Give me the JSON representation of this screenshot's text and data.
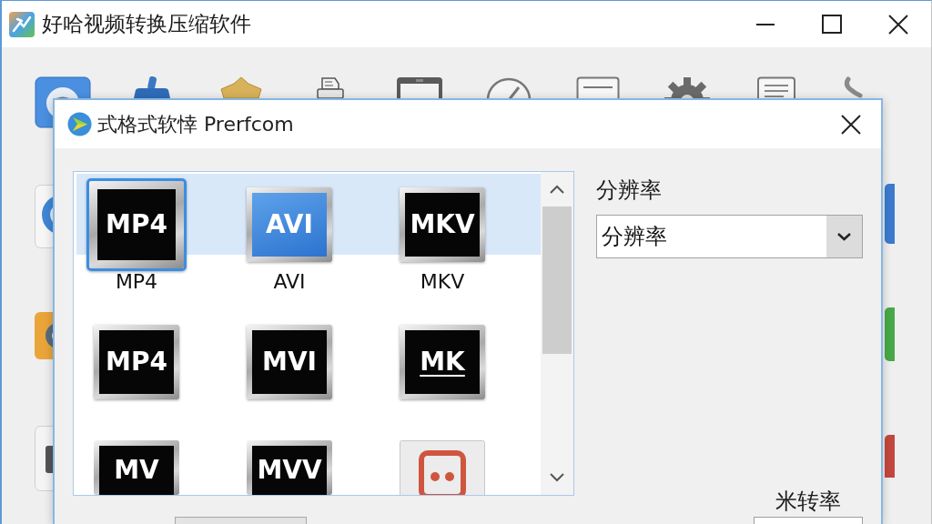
{
  "window": {
    "title": "好哈视频转换压缩软件"
  },
  "dialog": {
    "title": "式格式软悻 Prerfcom"
  },
  "format_list": {
    "rows": [
      {
        "highlighted": true,
        "items": [
          {
            "kind": "dark",
            "badge": "MP4",
            "label": "MP4",
            "selected": true
          },
          {
            "kind": "blue",
            "badge": "AVI",
            "label": "AVI",
            "selected": false
          },
          {
            "kind": "dark",
            "badge": "MKV",
            "label": "MKV",
            "selected": false
          }
        ]
      },
      {
        "highlighted": false,
        "items": [
          {
            "kind": "dark",
            "badge": "MP4",
            "selected": false
          },
          {
            "kind": "dark",
            "badge": "MVI",
            "selected": false
          },
          {
            "kind": "underlined",
            "badge": "MK",
            "selected": false
          }
        ]
      },
      {
        "highlighted": false,
        "items": [
          {
            "kind": "dark",
            "badge": "MV",
            "selected": false
          },
          {
            "kind": "dark",
            "badge": "MVV",
            "selected": false
          },
          {
            "kind": "app",
            "selected": false
          }
        ]
      }
    ]
  },
  "resolution": {
    "label": "分辨率",
    "value": "分辨率"
  },
  "rate": {
    "label": "米转率"
  }
}
